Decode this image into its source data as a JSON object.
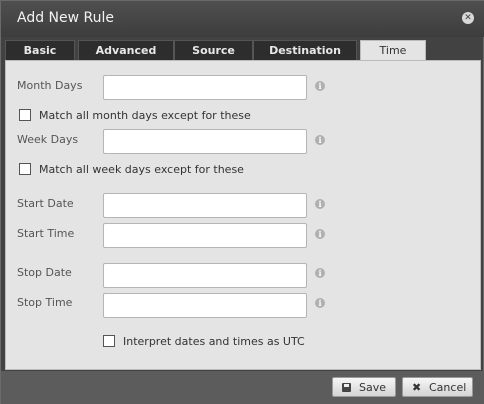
{
  "dialog": {
    "title": "Add New Rule",
    "close_icon": "close-icon"
  },
  "tabs": [
    {
      "label": "Basic",
      "active": false
    },
    {
      "label": "Advanced",
      "active": false
    },
    {
      "label": "Source",
      "active": false
    },
    {
      "label": "Destination",
      "active": false
    },
    {
      "label": "Time",
      "active": true
    }
  ],
  "form": {
    "month_days": {
      "label": "Month Days",
      "value": "",
      "info_icon": "info-icon"
    },
    "month_days_except": {
      "label": "Match all month days except for these",
      "checked": false
    },
    "week_days": {
      "label": "Week Days",
      "value": "",
      "info_icon": "info-icon"
    },
    "week_days_except": {
      "label": "Match all week days except for these",
      "checked": false
    },
    "start_date": {
      "label": "Start Date",
      "value": ""
    },
    "start_time": {
      "label": "Start Time",
      "value": ""
    },
    "stop_date": {
      "label": "Stop Date",
      "value": ""
    },
    "stop_time": {
      "label": "Stop Time",
      "value": ""
    },
    "utc": {
      "label": "Interpret dates and times as UTC",
      "checked": false
    }
  },
  "footer": {
    "save_label": "Save",
    "save_icon": "save-icon",
    "cancel_label": "Cancel",
    "cancel_icon": "cancel-icon"
  }
}
